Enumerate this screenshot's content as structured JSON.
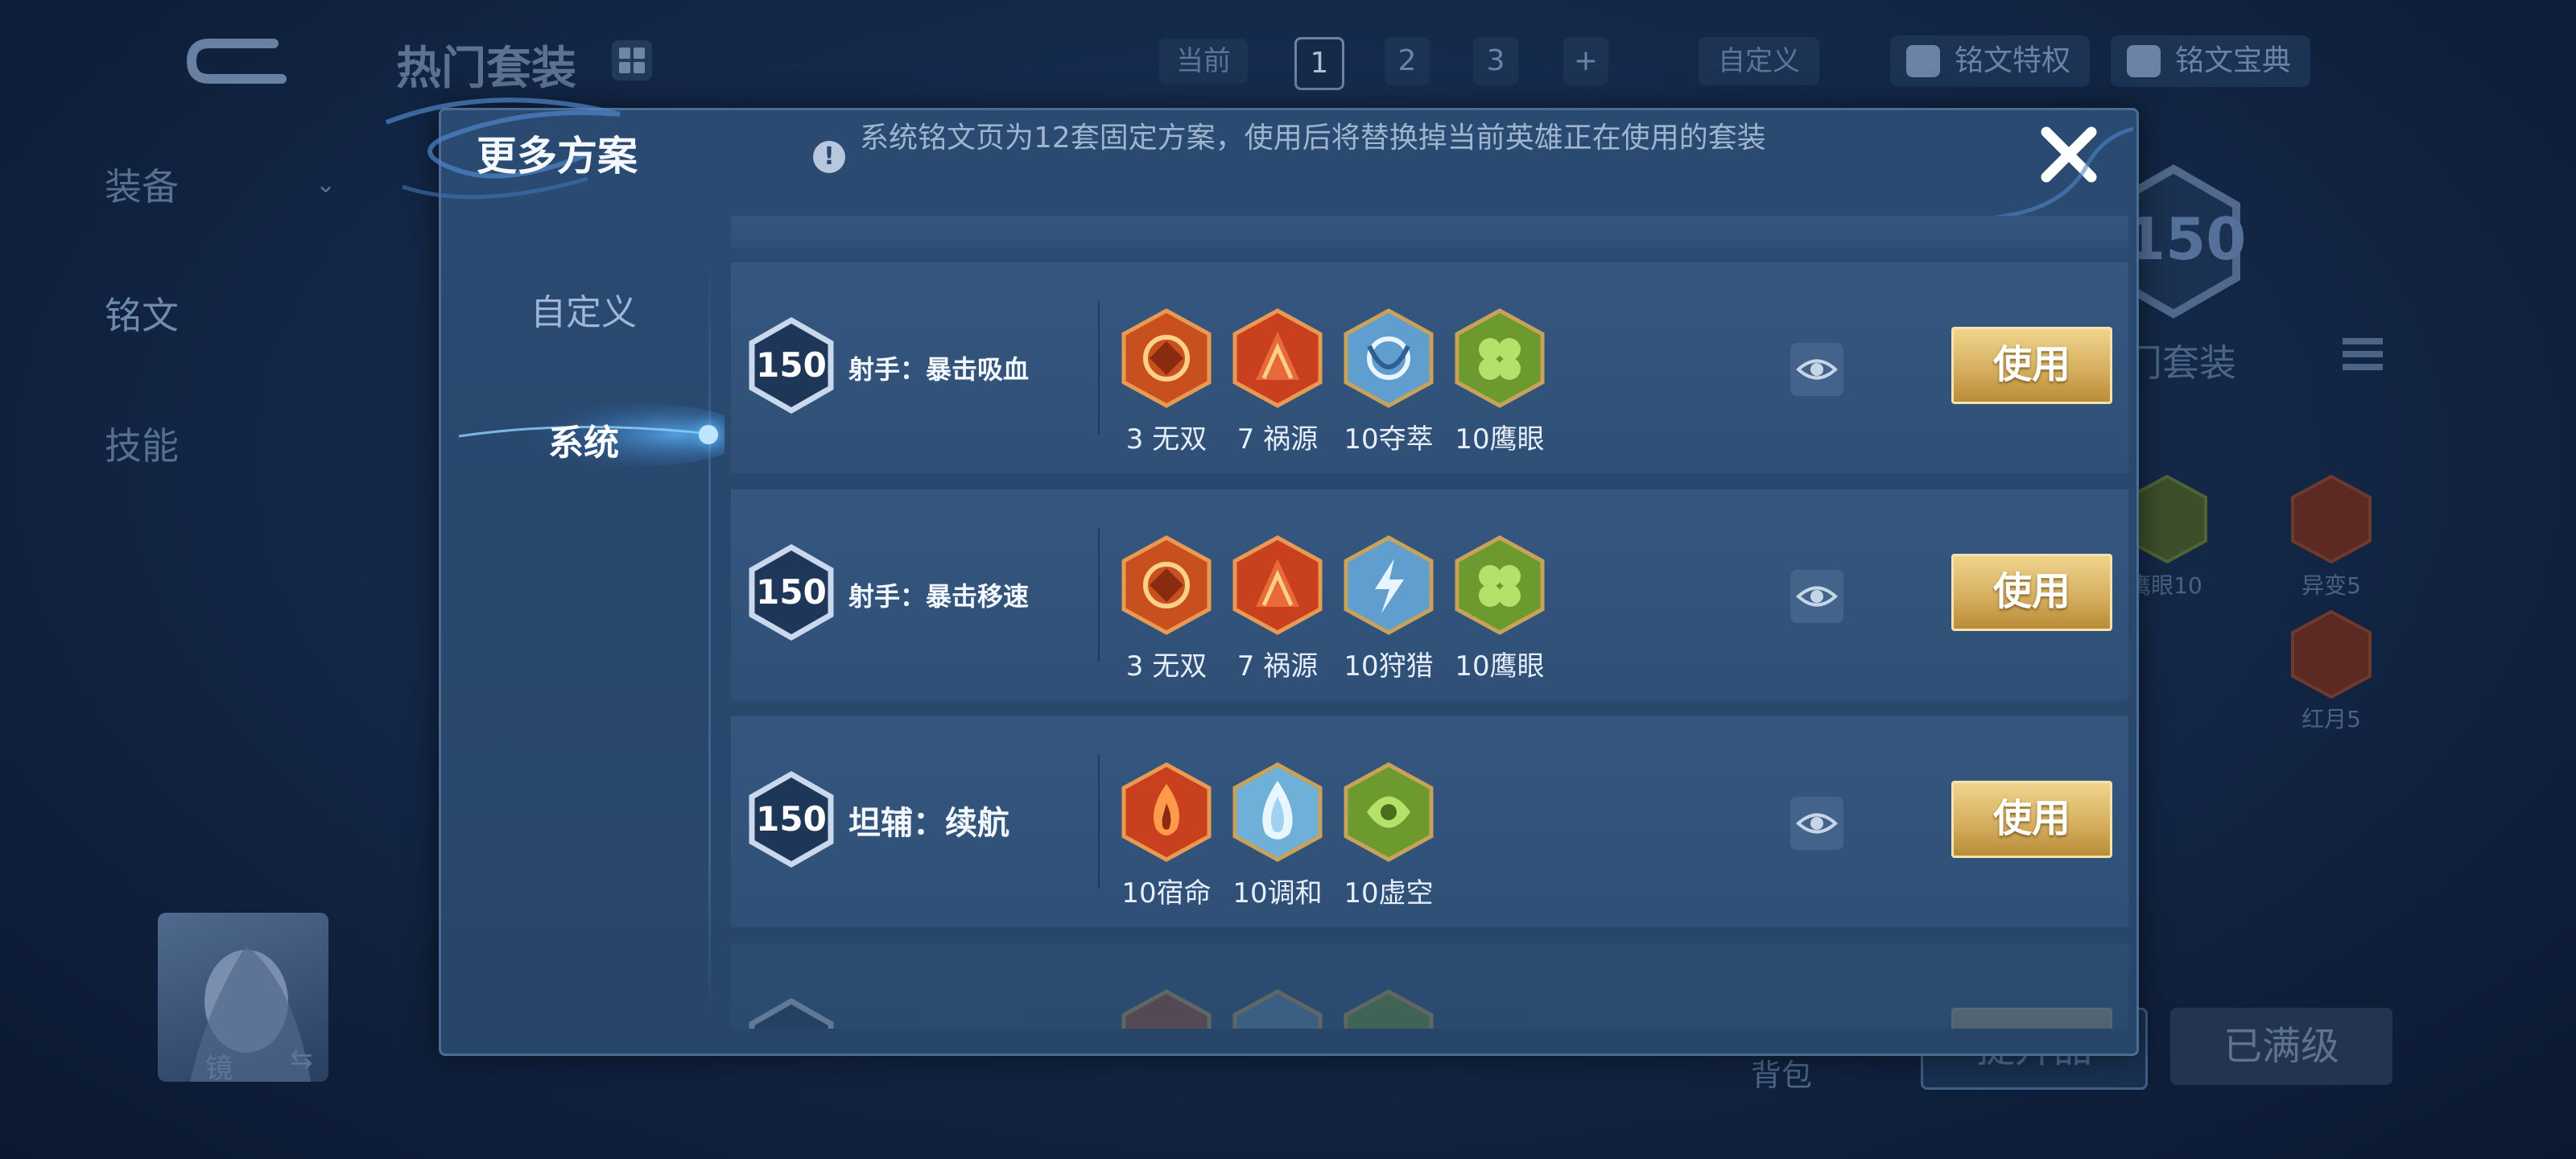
{
  "background": {
    "title": "热门套装",
    "side_nav": [
      "装备",
      "铭文",
      "技能"
    ],
    "current_label": "当前",
    "pages": [
      "1",
      "2",
      "3",
      "+"
    ],
    "custom_label": "自定义",
    "privilege_btn": "铭文特权",
    "codex_btn": "铭文宝典",
    "big_level": "150",
    "hot_set_label": "门套装",
    "runes": [
      {
        "label": "鹰眼10",
        "color": "#6a8a2c"
      },
      {
        "label": "异变5",
        "color": "#a13c26"
      },
      {
        "label": "红月5",
        "color": "#a13c26"
      }
    ],
    "hero_name": "镜",
    "swap_glyph": "⇆",
    "backpack": "背包",
    "upgrade_btn": "提升品",
    "maxed_btn": "已满级"
  },
  "modal": {
    "title": "更多方案",
    "notice": "系统铭文页为12套固定方案，使用后将替换掉当前英雄正在使用的套装",
    "tabs": {
      "custom": "自定义",
      "system": "系统"
    },
    "rows": [
      {
        "level": "150",
        "name": "射手：暴击吸血",
        "runes": [
          {
            "label": "3 无双",
            "color": "#c8501e",
            "icon": "spiral-rune-icon"
          },
          {
            "label": "7 祸源",
            "color": "#c8401e",
            "icon": "fan-rune-icon"
          },
          {
            "label": "10夺萃",
            "color": "#5f9ecf",
            "icon": "knot-rune-icon"
          },
          {
            "label": "10鹰眼",
            "color": "#6c9a2e",
            "icon": "clover-rune-icon"
          }
        ],
        "use_label": "使用"
      },
      {
        "level": "150",
        "name": "射手：暴击移速",
        "runes": [
          {
            "label": "3 无双",
            "color": "#c8501e",
            "icon": "spiral-rune-icon"
          },
          {
            "label": "7 祸源",
            "color": "#c8401e",
            "icon": "fan-rune-icon"
          },
          {
            "label": "10狩猎",
            "color": "#5f9ecf",
            "icon": "lightning-rune-icon"
          },
          {
            "label": "10鹰眼",
            "color": "#6c9a2e",
            "icon": "clover-rune-icon"
          }
        ],
        "use_label": "使用"
      },
      {
        "level": "150",
        "name": "坦辅：续航",
        "runes": [
          {
            "label": "10宿命",
            "color": "#c8401e",
            "icon": "flame-rune-icon"
          },
          {
            "label": "10调和",
            "color": "#6fb0d8",
            "icon": "drop-rune-icon"
          },
          {
            "label": "10虚空",
            "color": "#6c9a2e",
            "icon": "leaf-rune-icon"
          }
        ],
        "use_label": "使用"
      }
    ]
  }
}
